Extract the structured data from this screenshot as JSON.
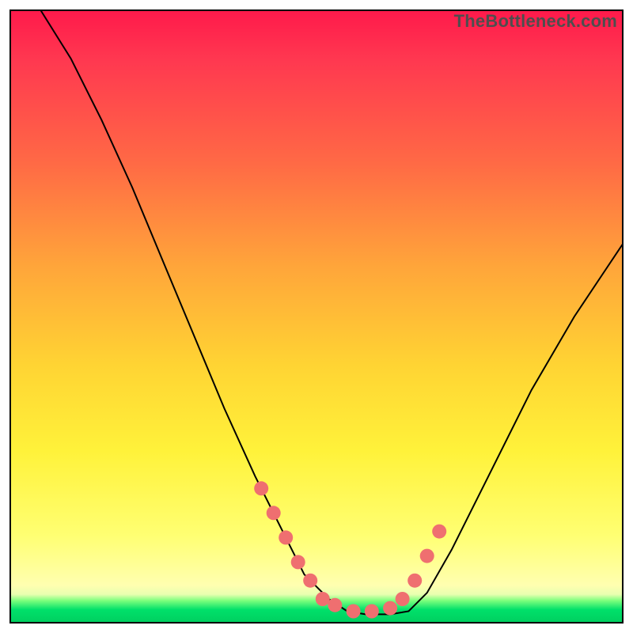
{
  "watermark": "TheBottleneck.com",
  "colors": {
    "frame": "#000000",
    "curve": "#000000",
    "bead": "#ef6f70",
    "gradient_top": "#ff1a4b",
    "gradient_mid": "#ffd433",
    "gradient_bottom": "#00d060"
  },
  "chart_data": {
    "type": "line",
    "title": "",
    "xlabel": "",
    "ylabel": "",
    "xlim": [
      0,
      100
    ],
    "ylim": [
      0,
      100
    ],
    "note": "Heat-gradient background with an asymmetric V-shaped curve; minimum plateau near x≈55–65 at the bottom. Salmon beads mark points along the lower legs of the curve. Axes have no tick labels.",
    "series": [
      {
        "name": "curve",
        "x": [
          5,
          10,
          15,
          20,
          25,
          30,
          35,
          40,
          45,
          48,
          52,
          55,
          58,
          62,
          65,
          68,
          72,
          78,
          85,
          92,
          100
        ],
        "y": [
          100,
          92,
          82,
          71,
          59,
          47,
          35,
          24,
          14,
          8,
          4,
          2,
          1.5,
          1.5,
          2,
          5,
          12,
          24,
          38,
          50,
          62
        ]
      },
      {
        "name": "beads",
        "x": [
          41,
          43,
          45,
          47,
          49,
          51,
          53,
          56,
          59,
          62,
          64,
          66,
          68,
          70
        ],
        "y": [
          22,
          18,
          14,
          10,
          7,
          4,
          3,
          2,
          2,
          2.5,
          4,
          7,
          11,
          15
        ]
      }
    ]
  }
}
